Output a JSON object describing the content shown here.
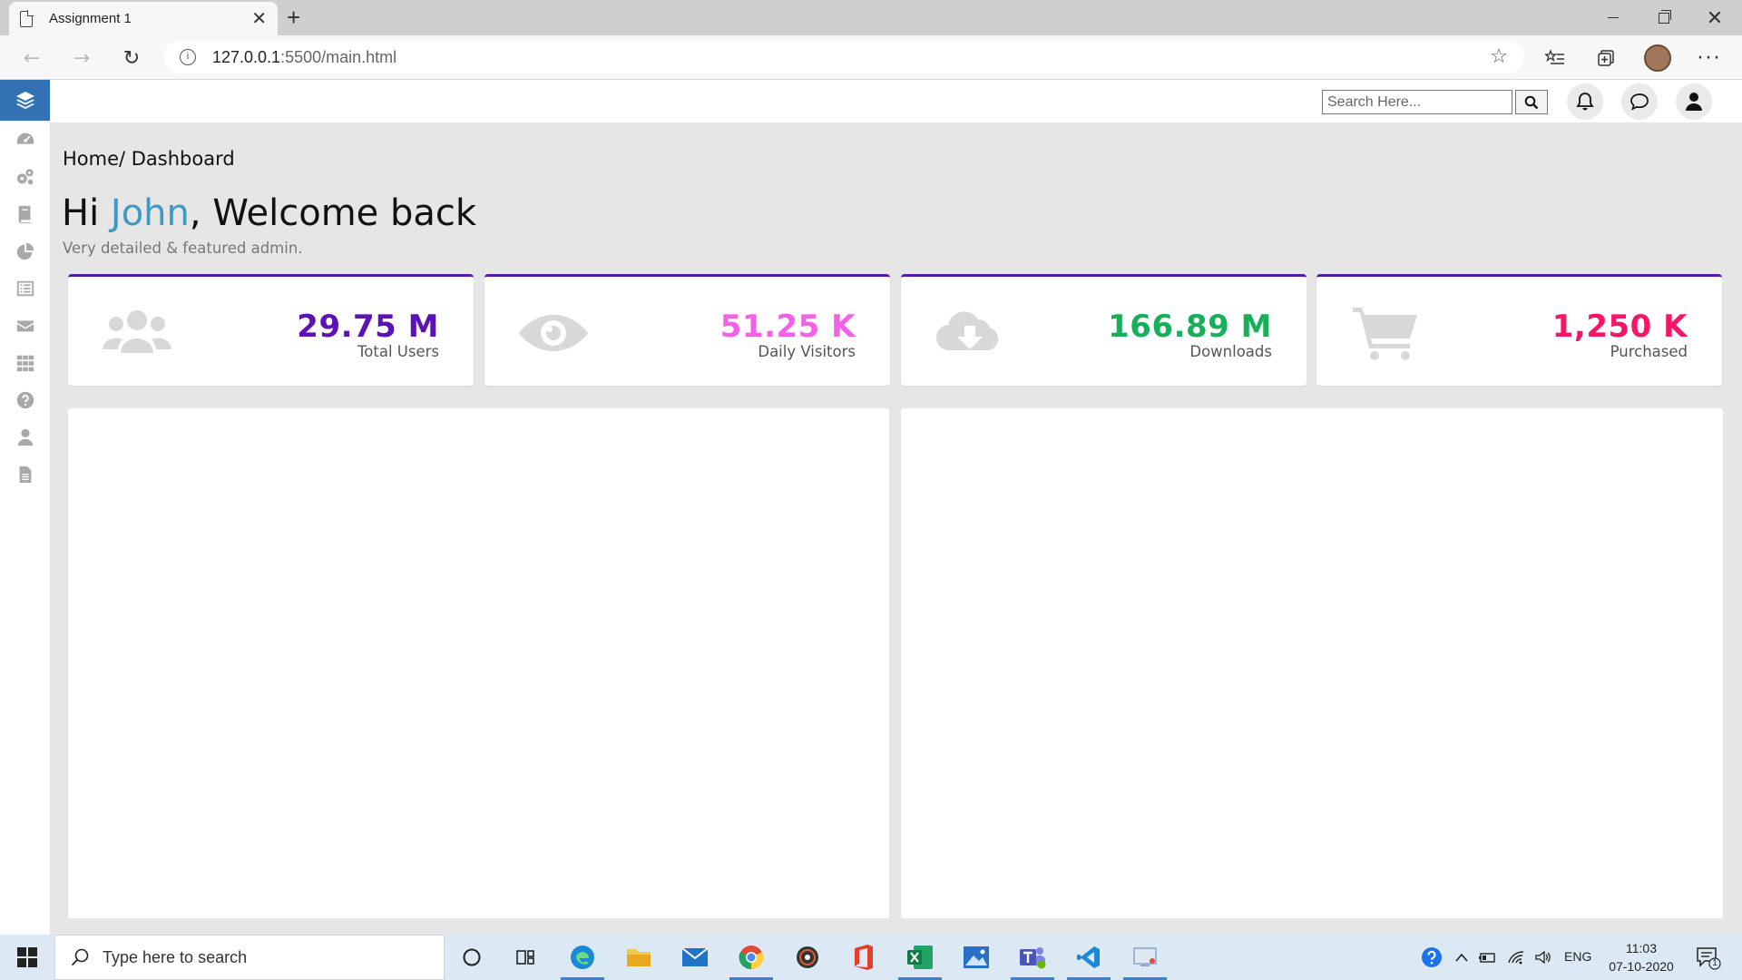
{
  "browser": {
    "tab_title": "Assignment 1",
    "url_host": "127.0.0.1",
    "url_path": ":5500/main.html"
  },
  "header": {
    "search_placeholder": "Search Here..."
  },
  "breadcrumb": "Home/ Dashboard",
  "greeting": {
    "prefix": "Hi ",
    "name": "John",
    "suffix": ", Welcome back",
    "subtitle": "Very detailed & featured admin."
  },
  "stats": [
    {
      "value": "29.75 M",
      "label": "Total Users",
      "color": "#5b13b8",
      "icon": "users-icon"
    },
    {
      "value": "51.25 K",
      "label": "Daily Visitors",
      "color": "#f660e9",
      "icon": "eye-icon"
    },
    {
      "value": "166.89 M",
      "label": "Downloads",
      "color": "#16b05a",
      "icon": "cloud-download-icon"
    },
    {
      "value": "1,250 K",
      "label": "Purchased",
      "color": "#f61566",
      "icon": "cart-icon"
    }
  ],
  "sidebar_icons": [
    "dashboard-icon",
    "settings-icon",
    "book-icon",
    "pie-chart-icon",
    "list-icon",
    "mail-icon",
    "grid-icon",
    "help-icon",
    "user-icon",
    "file-icon"
  ],
  "taskbar": {
    "search_placeholder": "Type here to search",
    "time": "11:03",
    "date": "07-10-2020",
    "language": "ENG",
    "notifications": "1"
  },
  "colors": {
    "accent": "#3373b3",
    "card_border": "#5b17a8",
    "name_highlight": "#3e99c5"
  }
}
